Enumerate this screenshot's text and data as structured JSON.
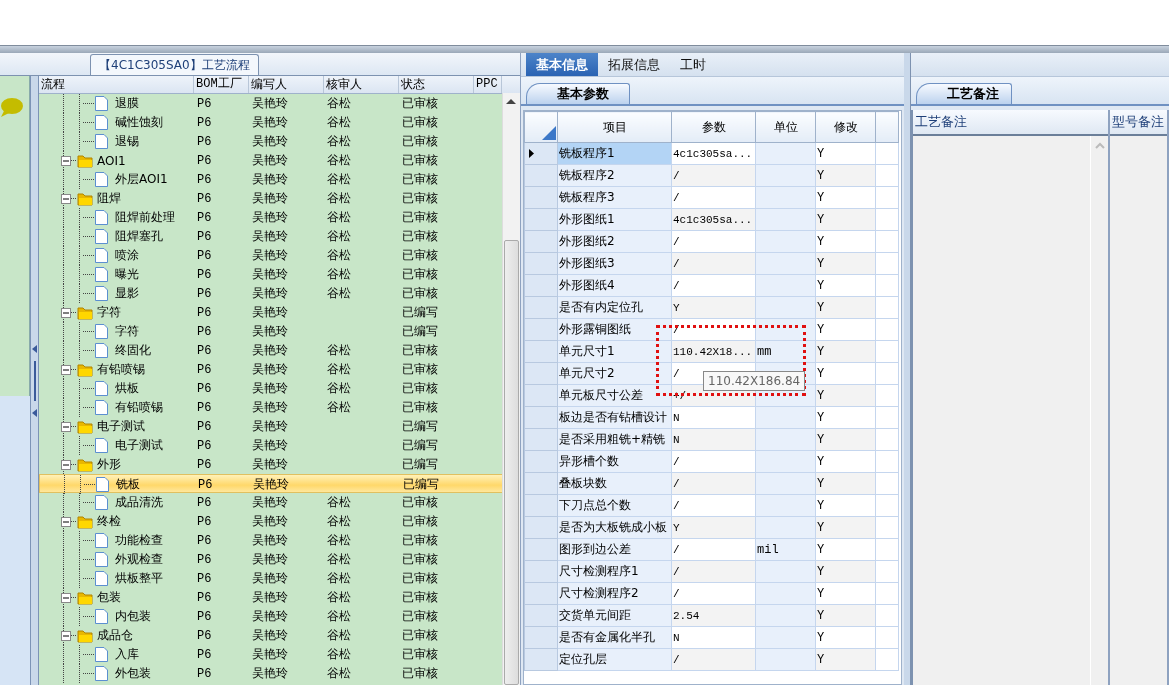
{
  "flow_panel": {
    "title": "【4C1C305SA0】工艺流程",
    "columns": [
      "流程",
      "BOM工厂",
      "编写人",
      "核审人",
      "状态",
      "PPC"
    ],
    "nodes": [
      {
        "kind": "hidden",
        "children": [
          {
            "kind": "leaf",
            "name": "退膜",
            "bom": "P6",
            "author": "吴艳玲",
            "reviewer": "谷松",
            "status": "已审核",
            "selected": false
          },
          {
            "kind": "leaf",
            "name": "碱性蚀刻",
            "bom": "P6",
            "author": "吴艳玲",
            "reviewer": "谷松",
            "status": "已审核",
            "selected": false
          },
          {
            "kind": "leaf",
            "name": "退锡",
            "bom": "P6",
            "author": "吴艳玲",
            "reviewer": "谷松",
            "status": "已审核",
            "selected": false
          }
        ]
      },
      {
        "kind": "folder",
        "expanded": true,
        "name": "AOI1",
        "bom": "P6",
        "author": "吴艳玲",
        "reviewer": "谷松",
        "status": "已审核",
        "selected": false,
        "children": [
          {
            "kind": "leaf",
            "name": "外层AOI1",
            "bom": "P6",
            "author": "吴艳玲",
            "reviewer": "谷松",
            "status": "已审核",
            "selected": false
          }
        ]
      },
      {
        "kind": "folder",
        "expanded": true,
        "name": "阻焊",
        "bom": "P6",
        "author": "吴艳玲",
        "reviewer": "谷松",
        "status": "已审核",
        "selected": false,
        "children": [
          {
            "kind": "leaf",
            "name": "阻焊前处理",
            "bom": "P6",
            "author": "吴艳玲",
            "reviewer": "谷松",
            "status": "已审核",
            "selected": false
          },
          {
            "kind": "leaf",
            "name": "阻焊塞孔",
            "bom": "P6",
            "author": "吴艳玲",
            "reviewer": "谷松",
            "status": "已审核",
            "selected": false
          },
          {
            "kind": "leaf",
            "name": "喷涂",
            "bom": "P6",
            "author": "吴艳玲",
            "reviewer": "谷松",
            "status": "已审核",
            "selected": false
          },
          {
            "kind": "leaf",
            "name": "曝光",
            "bom": "P6",
            "author": "吴艳玲",
            "reviewer": "谷松",
            "status": "已审核",
            "selected": false
          },
          {
            "kind": "leaf",
            "name": "显影",
            "bom": "P6",
            "author": "吴艳玲",
            "reviewer": "谷松",
            "status": "已审核",
            "selected": false
          }
        ]
      },
      {
        "kind": "folder",
        "expanded": true,
        "name": "字符",
        "bom": "P6",
        "author": "吴艳玲",
        "status": "已编写",
        "selected": false,
        "children": [
          {
            "kind": "leaf",
            "name": "字符",
            "bom": "P6",
            "author": "吴艳玲",
            "status": "已编写",
            "selected": false
          },
          {
            "kind": "leaf",
            "name": "终固化",
            "bom": "P6",
            "author": "吴艳玲",
            "reviewer": "谷松",
            "status": "已审核",
            "selected": false
          }
        ]
      },
      {
        "kind": "folder",
        "expanded": true,
        "name": "有铅喷锡",
        "bom": "P6",
        "author": "吴艳玲",
        "reviewer": "谷松",
        "status": "已审核",
        "selected": false,
        "children": [
          {
            "kind": "leaf",
            "name": "烘板",
            "bom": "P6",
            "author": "吴艳玲",
            "reviewer": "谷松",
            "status": "已审核",
            "selected": false
          },
          {
            "kind": "leaf",
            "name": "有铅喷锡",
            "bom": "P6",
            "author": "吴艳玲",
            "reviewer": "谷松",
            "status": "已审核",
            "selected": false
          }
        ]
      },
      {
        "kind": "folder",
        "expanded": true,
        "name": "电子测试",
        "bom": "P6",
        "author": "吴艳玲",
        "status": "已编写",
        "selected": false,
        "children": [
          {
            "kind": "leaf",
            "name": "电子测试",
            "bom": "P6",
            "author": "吴艳玲",
            "status": "已编写",
            "selected": false
          }
        ]
      },
      {
        "kind": "folder",
        "expanded": true,
        "name": "外形",
        "bom": "P6",
        "author": "吴艳玲",
        "status": "已编写",
        "selected": false,
        "children": [
          {
            "kind": "leaf",
            "name": "铣板",
            "bom": "P6",
            "author": "吴艳玲",
            "status": "已编写",
            "selected": true
          },
          {
            "kind": "leaf",
            "name": "成品清洗",
            "bom": "P6",
            "author": "吴艳玲",
            "reviewer": "谷松",
            "status": "已审核",
            "selected": false
          }
        ]
      },
      {
        "kind": "folder",
        "expanded": true,
        "name": "终检",
        "bom": "P6",
        "author": "吴艳玲",
        "reviewer": "谷松",
        "status": "已审核",
        "selected": false,
        "children": [
          {
            "kind": "leaf",
            "name": "功能检查",
            "bom": "P6",
            "author": "吴艳玲",
            "reviewer": "谷松",
            "status": "已审核",
            "selected": false
          },
          {
            "kind": "leaf",
            "name": "外观检查",
            "bom": "P6",
            "author": "吴艳玲",
            "reviewer": "谷松",
            "status": "已审核",
            "selected": false
          },
          {
            "kind": "leaf",
            "name": "烘板整平",
            "bom": "P6",
            "author": "吴艳玲",
            "reviewer": "谷松",
            "status": "已审核",
            "selected": false
          }
        ]
      },
      {
        "kind": "folder",
        "expanded": true,
        "name": "包装",
        "bom": "P6",
        "author": "吴艳玲",
        "reviewer": "谷松",
        "status": "已审核",
        "selected": false,
        "children": [
          {
            "kind": "leaf",
            "name": "内包装",
            "bom": "P6",
            "author": "吴艳玲",
            "reviewer": "谷松",
            "status": "已审核",
            "selected": false
          }
        ]
      },
      {
        "kind": "folder",
        "expanded": true,
        "name": "成品仓",
        "bom": "P6",
        "author": "吴艳玲",
        "reviewer": "谷松",
        "status": "已审核",
        "selected": false,
        "children": [
          {
            "kind": "leaf",
            "name": "入库",
            "bom": "P6",
            "author": "吴艳玲",
            "reviewer": "谷松",
            "status": "已审核",
            "selected": false
          },
          {
            "kind": "leaf",
            "name": "外包装",
            "bom": "P6",
            "author": "吴艳玲",
            "reviewer": "谷松",
            "status": "已审核",
            "selected": false
          }
        ]
      }
    ]
  },
  "info_panel": {
    "tabs": [
      {
        "label": "基本信息",
        "selected": true
      },
      {
        "label": "拓展信息",
        "selected": false
      },
      {
        "label": "工时",
        "selected": false
      }
    ],
    "subtab": "基本参数",
    "columns": [
      "项目",
      "参数",
      "单位",
      "修改"
    ],
    "rows": [
      {
        "item": "铣板程序1",
        "param": "4c1c305sa...",
        "modify": "Y",
        "selected": true
      },
      {
        "item": "铣板程序2",
        "param": "/",
        "modify": "Y",
        "selected": false
      },
      {
        "item": "铣板程序3",
        "param": "/",
        "modify": "Y",
        "selected": false
      },
      {
        "item": "外形图纸1",
        "param": "4c1c305sa...",
        "modify": "Y",
        "selected": false
      },
      {
        "item": "外形图纸2",
        "param": "/",
        "modify": "Y",
        "selected": false
      },
      {
        "item": "外形图纸3",
        "param": "/",
        "modify": "Y",
        "selected": false
      },
      {
        "item": "外形图纸4",
        "param": "/",
        "modify": "Y",
        "selected": false
      },
      {
        "item": "是否有内定位孔",
        "param": "Y",
        "modify": "Y",
        "selected": false
      },
      {
        "item": "外形露铜图纸",
        "param": "/",
        "modify": "Y",
        "selected": false
      },
      {
        "item": "单元尺寸1",
        "param": "110.42X18...",
        "unit": "mm",
        "modify": "Y",
        "selected": false
      },
      {
        "item": "单元尺寸2",
        "param": "/",
        "modify": "Y",
        "selected": false
      },
      {
        "item": "单元板尺寸公差",
        "param": "+/",
        "modify": "Y",
        "selected": false
      },
      {
        "item": "板边是否有钻槽设计",
        "param": "N",
        "modify": "Y",
        "selected": false
      },
      {
        "item": "是否采用粗铣+精铣",
        "param": "N",
        "modify": "Y",
        "selected": false
      },
      {
        "item": "异形槽个数",
        "param": "/",
        "modify": "Y",
        "selected": false
      },
      {
        "item": "叠板块数",
        "param": "/",
        "modify": "Y",
        "selected": false
      },
      {
        "item": "下刀点总个数",
        "param": "/",
        "modify": "Y",
        "selected": false
      },
      {
        "item": "是否为大板铣成小板",
        "param": "Y",
        "modify": "Y",
        "selected": false
      },
      {
        "item": "图形到边公差",
        "param": "/",
        "unit": "mil",
        "modify": "Y",
        "selected": false
      },
      {
        "item": "尺寸检测程序1",
        "param": "/",
        "modify": "Y",
        "selected": false
      },
      {
        "item": "尺寸检测程序2",
        "param": "/",
        "modify": "Y",
        "selected": false
      },
      {
        "item": "交货单元间距",
        "param": "2.54",
        "modify": "Y",
        "selected": false
      },
      {
        "item": "是否有金属化半孔",
        "param": "N",
        "modify": "Y",
        "selected": false
      },
      {
        "item": "定位孔层",
        "param": "/",
        "modify": "Y",
        "selected": false
      }
    ],
    "tooltip": "110.42X186.84"
  },
  "notes_panel": {
    "tab": "工艺备注",
    "columns": [
      "工艺备注",
      "型号备注"
    ]
  }
}
